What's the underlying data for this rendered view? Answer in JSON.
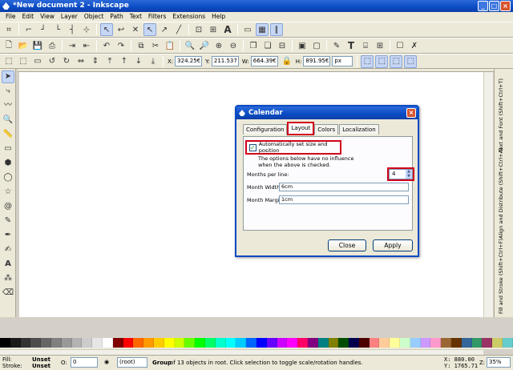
{
  "window": {
    "title": "*New document 2 - Inkscape",
    "min": "_",
    "max": "□",
    "close": "×"
  },
  "menu": [
    "File",
    "Edit",
    "View",
    "Layer",
    "Object",
    "Path",
    "Text",
    "Filters",
    "Extensions",
    "Help"
  ],
  "tool_controls": {
    "x_label": "X:",
    "x_value": "324.25€",
    "y_label": "Y:",
    "y_value": "211.537",
    "w_label": "W:",
    "w_value": "664.39€",
    "h_label": "H:",
    "h_value": "891.95€",
    "unit": "px"
  },
  "dialog": {
    "title": "Calendar",
    "close": "×",
    "tabs": [
      "Configuration",
      "Layout",
      "Colors",
      "Localization"
    ],
    "checkbox_label": "Automatically set size and position",
    "checkbox_checked": "✓",
    "note_line1": "The options below have no influence",
    "note_line2": "when the above is checked.",
    "months_per_line_label": "Months per line:",
    "months_per_line_value": "4",
    "spin_up": "▲",
    "spin_down": "▼",
    "month_width_label": "Month Width:",
    "month_width_value": "6cm",
    "month_margin_label": "Month Margin:",
    "month_margin_value": "1cm",
    "close_button": "Close",
    "apply_button": "Apply"
  },
  "dock_tabs": [
    "Text and Font (Shift+Ctrl+T)",
    "Align and Distribute (Shift+Ctrl+A)",
    "Fill and Stroke (Shift+Ctrl+F)"
  ],
  "status": {
    "fill_label": "Fill:",
    "fill_value": "Unset",
    "stroke_label": "Stroke:",
    "stroke_value": "Unset",
    "opacity_label": "O:",
    "opacity_value": "0",
    "layer_value": "(root)",
    "message_bold": "Group",
    "message_rest": " of 13 objects in root. Click selection to toggle scale/rotation handles.",
    "x_coord": "X:  880.00",
    "y_coord": "Y: 1765.71",
    "zoom_label": "Z:",
    "zoom_value": "35%"
  },
  "palette": [
    "#000000",
    "#1a1a1a",
    "#333333",
    "#4d4d4d",
    "#666666",
    "#808080",
    "#999999",
    "#b3b3b3",
    "#cccccc",
    "#e6e6e6",
    "#ffffff",
    "#800000",
    "#ff0000",
    "#ff6600",
    "#ff9900",
    "#ffcc00",
    "#ffff00",
    "#ccff00",
    "#66ff00",
    "#00ff00",
    "#00ff66",
    "#00ffcc",
    "#00ffff",
    "#00ccff",
    "#0066ff",
    "#0000ff",
    "#6600ff",
    "#cc00ff",
    "#ff00ff",
    "#ff0066",
    "#800080",
    "#008080",
    "#808000",
    "#004d00",
    "#00004d",
    "#4d0000",
    "#ff8080",
    "#ffcc99",
    "#ffff99",
    "#ccffcc",
    "#99ccff",
    "#cc99ff",
    "#ff99cc",
    "#996633",
    "#663300",
    "#336699",
    "#339966",
    "#993366",
    "#cccc66",
    "#66cccc"
  ],
  "colors": {
    "highlight": "#d0021b",
    "titlebar": "#0a4bc4"
  }
}
